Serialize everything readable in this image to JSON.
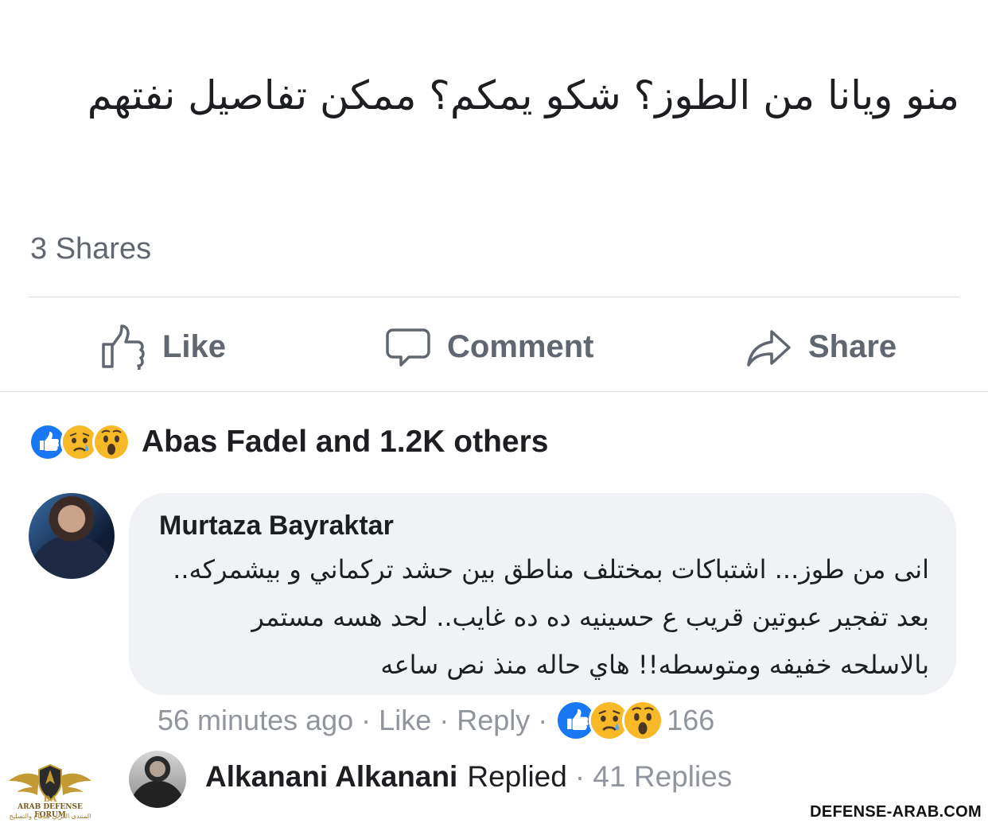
{
  "post": {
    "text": "منو ويانا من الطوز؟ شكو يمكم؟ ممكن تفاصيل نفتهم",
    "shares": "3 Shares"
  },
  "actions": {
    "like_label": "Like",
    "comment_label": "Comment",
    "share_label": "Share"
  },
  "reactions": {
    "icons": [
      "like-icon",
      "sad-icon",
      "wow-icon"
    ],
    "summary": "Abas Fadel and 1.2K others"
  },
  "comment": {
    "author": "Murtaza Bayraktar",
    "text": "انى من طوز... اشتباكات بمختلف مناطق بين حشد تركماني و بيشمركه.. بعد تفجير عبوتين قريب ع حسينيه ده ده غايب.. لحد هسه مستمر بالاسلحه خفيفه ومتوسطه!! هاي حاله منذ نص ساعه",
    "time": "56 minutes ago",
    "like_label": "Like",
    "reply_label": "Reply",
    "reaction_count": "166"
  },
  "reply": {
    "author": "Alkanani Alkanani",
    "action": "Replied",
    "count": "· 41 Replies"
  },
  "watermark": {
    "logo_line1": "DA",
    "logo_line2": "ARAB DEFENSE FORUM",
    "logo_line3": "المنتدى العربي للدفاع والتسليح",
    "site": "DEFENSE-ARAB.COM"
  },
  "colors": {
    "like_blue": "#1877f2",
    "emoji_yellow": "#f7b928",
    "muted": "#606770",
    "bubble": "#f0f2f5"
  }
}
